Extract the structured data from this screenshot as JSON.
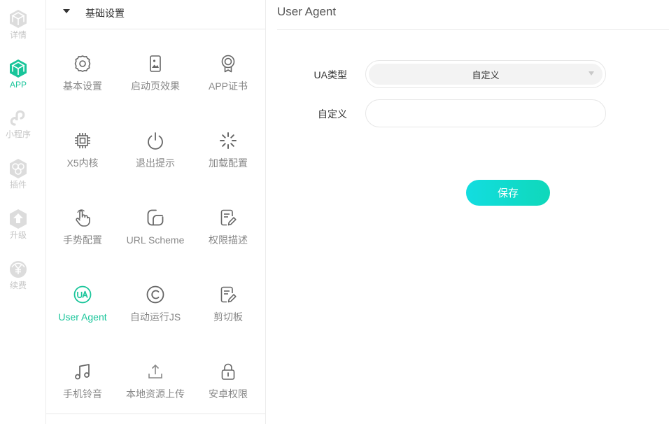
{
  "colors": {
    "accent": "#19c59a",
    "rail_inactive": "#c6c6c6",
    "tile_icon": "#666666",
    "save_gradient_start": "#12dde0",
    "save_gradient_end": "#0fd8ba"
  },
  "rail": {
    "items": [
      {
        "label": "详情",
        "icon": "cube-outline-icon",
        "active": false
      },
      {
        "label": "APP",
        "icon": "cube-icon",
        "active": true
      },
      {
        "label": "小程序",
        "icon": "mini-program-icon",
        "active": false
      },
      {
        "label": "插件",
        "icon": "plugin-hexagons-icon",
        "active": false
      },
      {
        "label": "升级",
        "icon": "upgrade-arrow-icon",
        "active": false
      },
      {
        "label": "续费",
        "icon": "renew-yuan-icon",
        "active": false
      }
    ]
  },
  "panel": {
    "section_title": "基础设置",
    "tiles": [
      {
        "label": "基本设置",
        "icon": "gear-icon"
      },
      {
        "label": "启动页效果",
        "icon": "splash-image-icon"
      },
      {
        "label": "APP证书",
        "icon": "certificate-badge-icon"
      },
      {
        "label": "X5内核",
        "icon": "chip-icon"
      },
      {
        "label": "退出提示",
        "icon": "power-icon"
      },
      {
        "label": "加载配置",
        "icon": "loading-spinner-icon"
      },
      {
        "label": "手势配置",
        "icon": "hand-gesture-icon"
      },
      {
        "label": "URL Scheme",
        "icon": "url-scheme-icon"
      },
      {
        "label": "权限描述",
        "icon": "edit-document-icon"
      },
      {
        "label": "User Agent",
        "icon": "ua-icon",
        "active": true
      },
      {
        "label": "自动运行JS",
        "icon": "copyright-c-icon"
      },
      {
        "label": "剪切板",
        "icon": "clipboard-edit-icon"
      },
      {
        "label": "手机铃音",
        "icon": "music-note-icon"
      },
      {
        "label": "本地资源上传",
        "icon": "upload-icon"
      },
      {
        "label": "安卓权限",
        "icon": "lock-icon"
      }
    ]
  },
  "main": {
    "title": "User Agent",
    "ua_type_label": "UA类型",
    "ua_type_value": "自定义",
    "custom_label": "自定义",
    "custom_value": "",
    "custom_placeholder": "",
    "save_label": "保存"
  }
}
